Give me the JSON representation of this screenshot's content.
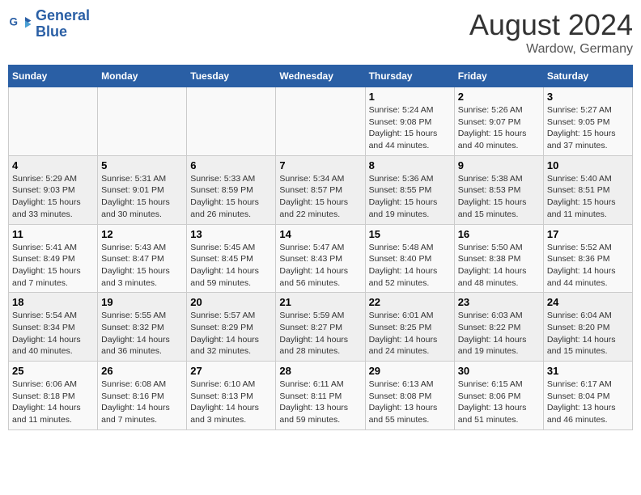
{
  "header": {
    "logo_line1": "General",
    "logo_line2": "Blue",
    "month_year": "August 2024",
    "location": "Wardow, Germany"
  },
  "weekdays": [
    "Sunday",
    "Monday",
    "Tuesday",
    "Wednesday",
    "Thursday",
    "Friday",
    "Saturday"
  ],
  "weeks": [
    [
      {
        "day": "",
        "info": ""
      },
      {
        "day": "",
        "info": ""
      },
      {
        "day": "",
        "info": ""
      },
      {
        "day": "",
        "info": ""
      },
      {
        "day": "1",
        "info": "Sunrise: 5:24 AM\nSunset: 9:08 PM\nDaylight: 15 hours\nand 44 minutes."
      },
      {
        "day": "2",
        "info": "Sunrise: 5:26 AM\nSunset: 9:07 PM\nDaylight: 15 hours\nand 40 minutes."
      },
      {
        "day": "3",
        "info": "Sunrise: 5:27 AM\nSunset: 9:05 PM\nDaylight: 15 hours\nand 37 minutes."
      }
    ],
    [
      {
        "day": "4",
        "info": "Sunrise: 5:29 AM\nSunset: 9:03 PM\nDaylight: 15 hours\nand 33 minutes."
      },
      {
        "day": "5",
        "info": "Sunrise: 5:31 AM\nSunset: 9:01 PM\nDaylight: 15 hours\nand 30 minutes."
      },
      {
        "day": "6",
        "info": "Sunrise: 5:33 AM\nSunset: 8:59 PM\nDaylight: 15 hours\nand 26 minutes."
      },
      {
        "day": "7",
        "info": "Sunrise: 5:34 AM\nSunset: 8:57 PM\nDaylight: 15 hours\nand 22 minutes."
      },
      {
        "day": "8",
        "info": "Sunrise: 5:36 AM\nSunset: 8:55 PM\nDaylight: 15 hours\nand 19 minutes."
      },
      {
        "day": "9",
        "info": "Sunrise: 5:38 AM\nSunset: 8:53 PM\nDaylight: 15 hours\nand 15 minutes."
      },
      {
        "day": "10",
        "info": "Sunrise: 5:40 AM\nSunset: 8:51 PM\nDaylight: 15 hours\nand 11 minutes."
      }
    ],
    [
      {
        "day": "11",
        "info": "Sunrise: 5:41 AM\nSunset: 8:49 PM\nDaylight: 15 hours\nand 7 minutes."
      },
      {
        "day": "12",
        "info": "Sunrise: 5:43 AM\nSunset: 8:47 PM\nDaylight: 15 hours\nand 3 minutes."
      },
      {
        "day": "13",
        "info": "Sunrise: 5:45 AM\nSunset: 8:45 PM\nDaylight: 14 hours\nand 59 minutes."
      },
      {
        "day": "14",
        "info": "Sunrise: 5:47 AM\nSunset: 8:43 PM\nDaylight: 14 hours\nand 56 minutes."
      },
      {
        "day": "15",
        "info": "Sunrise: 5:48 AM\nSunset: 8:40 PM\nDaylight: 14 hours\nand 52 minutes."
      },
      {
        "day": "16",
        "info": "Sunrise: 5:50 AM\nSunset: 8:38 PM\nDaylight: 14 hours\nand 48 minutes."
      },
      {
        "day": "17",
        "info": "Sunrise: 5:52 AM\nSunset: 8:36 PM\nDaylight: 14 hours\nand 44 minutes."
      }
    ],
    [
      {
        "day": "18",
        "info": "Sunrise: 5:54 AM\nSunset: 8:34 PM\nDaylight: 14 hours\nand 40 minutes."
      },
      {
        "day": "19",
        "info": "Sunrise: 5:55 AM\nSunset: 8:32 PM\nDaylight: 14 hours\nand 36 minutes."
      },
      {
        "day": "20",
        "info": "Sunrise: 5:57 AM\nSunset: 8:29 PM\nDaylight: 14 hours\nand 32 minutes."
      },
      {
        "day": "21",
        "info": "Sunrise: 5:59 AM\nSunset: 8:27 PM\nDaylight: 14 hours\nand 28 minutes."
      },
      {
        "day": "22",
        "info": "Sunrise: 6:01 AM\nSunset: 8:25 PM\nDaylight: 14 hours\nand 24 minutes."
      },
      {
        "day": "23",
        "info": "Sunrise: 6:03 AM\nSunset: 8:22 PM\nDaylight: 14 hours\nand 19 minutes."
      },
      {
        "day": "24",
        "info": "Sunrise: 6:04 AM\nSunset: 8:20 PM\nDaylight: 14 hours\nand 15 minutes."
      }
    ],
    [
      {
        "day": "25",
        "info": "Sunrise: 6:06 AM\nSunset: 8:18 PM\nDaylight: 14 hours\nand 11 minutes."
      },
      {
        "day": "26",
        "info": "Sunrise: 6:08 AM\nSunset: 8:16 PM\nDaylight: 14 hours\nand 7 minutes."
      },
      {
        "day": "27",
        "info": "Sunrise: 6:10 AM\nSunset: 8:13 PM\nDaylight: 14 hours\nand 3 minutes."
      },
      {
        "day": "28",
        "info": "Sunrise: 6:11 AM\nSunset: 8:11 PM\nDaylight: 13 hours\nand 59 minutes."
      },
      {
        "day": "29",
        "info": "Sunrise: 6:13 AM\nSunset: 8:08 PM\nDaylight: 13 hours\nand 55 minutes."
      },
      {
        "day": "30",
        "info": "Sunrise: 6:15 AM\nSunset: 8:06 PM\nDaylight: 13 hours\nand 51 minutes."
      },
      {
        "day": "31",
        "info": "Sunrise: 6:17 AM\nSunset: 8:04 PM\nDaylight: 13 hours\nand 46 minutes."
      }
    ]
  ]
}
